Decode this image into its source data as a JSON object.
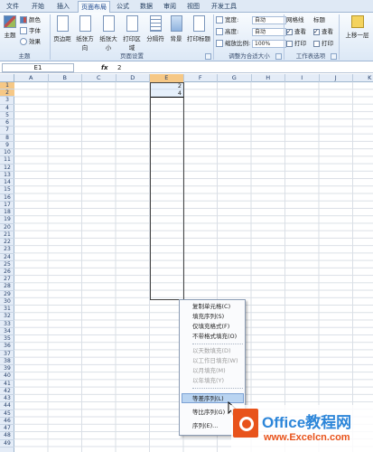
{
  "ribbon": {
    "tabs": [
      "文件",
      "开始",
      "插入",
      "页面布局",
      "公式",
      "数据",
      "审阅",
      "视图",
      "开发工具"
    ],
    "active_tab": "页面布局",
    "theme_group": {
      "label": "主题",
      "big": "主题",
      "colors": "颜色",
      "fonts": "字体",
      "effects": "效果"
    },
    "page_setup_group": {
      "label": "页面设置",
      "buttons": [
        "页边距",
        "纸张方向",
        "纸张大小",
        "打印区域",
        "分隔符",
        "背景",
        "打印标题"
      ]
    },
    "scale_group": {
      "label": "调整为合适大小",
      "width_label": "宽度:",
      "width_value": "自动",
      "height_label": "高度:",
      "height_value": "自动",
      "scale_label": "缩放比例:",
      "scale_value": "100%"
    },
    "sheet_options_group": {
      "label": "工作表选项",
      "gridlines": "网格线",
      "headings": "标题",
      "view": "查看",
      "print": "打印"
    },
    "arrange_group": {
      "bring_forward": "上移一层"
    }
  },
  "formula_bar": {
    "name_box": "E1",
    "fx": "fx",
    "value": "2"
  },
  "grid": {
    "columns": [
      "A",
      "B",
      "C",
      "D",
      "E",
      "F",
      "G",
      "H",
      "I",
      "J",
      "K"
    ],
    "selected_column": "E",
    "rows": [
      "1",
      "2",
      "3",
      "4",
      "5",
      "6",
      "7",
      "8",
      "9",
      "10",
      "11",
      "12",
      "13",
      "14",
      "15",
      "16",
      "17",
      "18",
      "19",
      "20",
      "21",
      "22",
      "23",
      "24",
      "25",
      "26",
      "27",
      "28",
      "29",
      "30",
      "31",
      "32",
      "33",
      "34",
      "35",
      "36",
      "37",
      "38",
      "39",
      "40",
      "41",
      "42",
      "43",
      "44",
      "45",
      "46",
      "47",
      "48",
      "49"
    ],
    "selected_rows": [
      "1",
      "2"
    ],
    "cells": {
      "E1": "2",
      "E2": "4"
    }
  },
  "context_menu": {
    "items": [
      {
        "label": "复制单元格(C)",
        "enabled": true
      },
      {
        "label": "填充序列(S)",
        "enabled": true
      },
      {
        "label": "仅填充格式(F)",
        "enabled": true
      },
      {
        "label": "不带格式填充(O)",
        "enabled": true
      },
      {
        "label": "以天数填充(D)",
        "enabled": false
      },
      {
        "label": "以工作日填充(W)",
        "enabled": false
      },
      {
        "label": "以月填充(M)",
        "enabled": false
      },
      {
        "label": "以年填充(Y)",
        "enabled": false
      },
      {
        "label": "等差序列(L)",
        "enabled": true,
        "highlighted": true
      },
      {
        "label": "等比序列(G)",
        "enabled": true
      },
      {
        "label": "序列(E)...",
        "enabled": true
      }
    ]
  },
  "watermark": {
    "title": "Office教程网",
    "site": "www.Excelcn.com"
  },
  "colors": {
    "selection_header": "#f6c886",
    "menu_highlight": "#b9d4f1",
    "ribbon_bg": "#dce8f6"
  }
}
